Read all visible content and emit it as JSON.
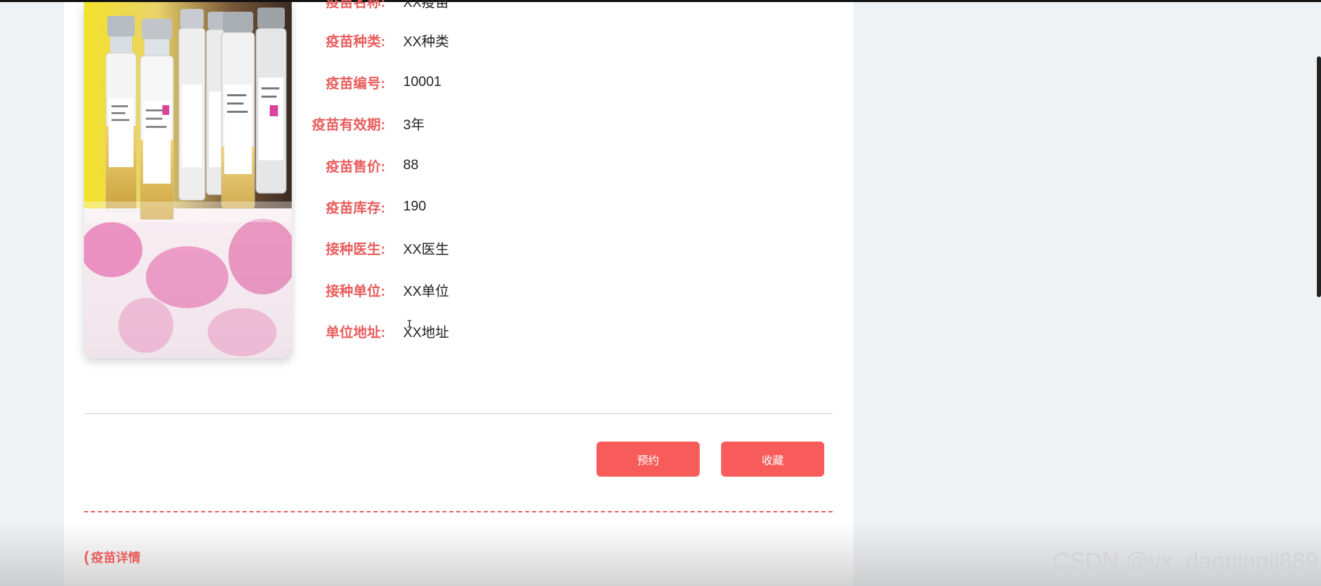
{
  "colors": {
    "accent": "#e85d5d",
    "button_bg": "#f75c5b",
    "page_bg": "#eef2f4",
    "panel_bg": "#ffffff"
  },
  "product": {
    "image_icon": "vaccine-vials-photo",
    "details": [
      {
        "label": "疫苗名称:",
        "value": "XX疫苗"
      },
      {
        "label": "疫苗种类:",
        "value": "XX种类"
      },
      {
        "label": "疫苗编号:",
        "value": "10001"
      },
      {
        "label": "疫苗有效期:",
        "value": "3年"
      },
      {
        "label": "疫苗售价:",
        "value": "88"
      },
      {
        "label": "疫苗库存:",
        "value": "190"
      },
      {
        "label": "接种医生:",
        "value": "XX医生"
      },
      {
        "label": "接种单位:",
        "value": "XX单位"
      },
      {
        "label": "单位地址:",
        "value": "XX地址"
      }
    ]
  },
  "actions": {
    "book_label": "预约",
    "collect_label": "收藏"
  },
  "section": {
    "bracket": "(",
    "title": "疫苗详情"
  },
  "watermark": "CSDN @vx_danpianji889"
}
